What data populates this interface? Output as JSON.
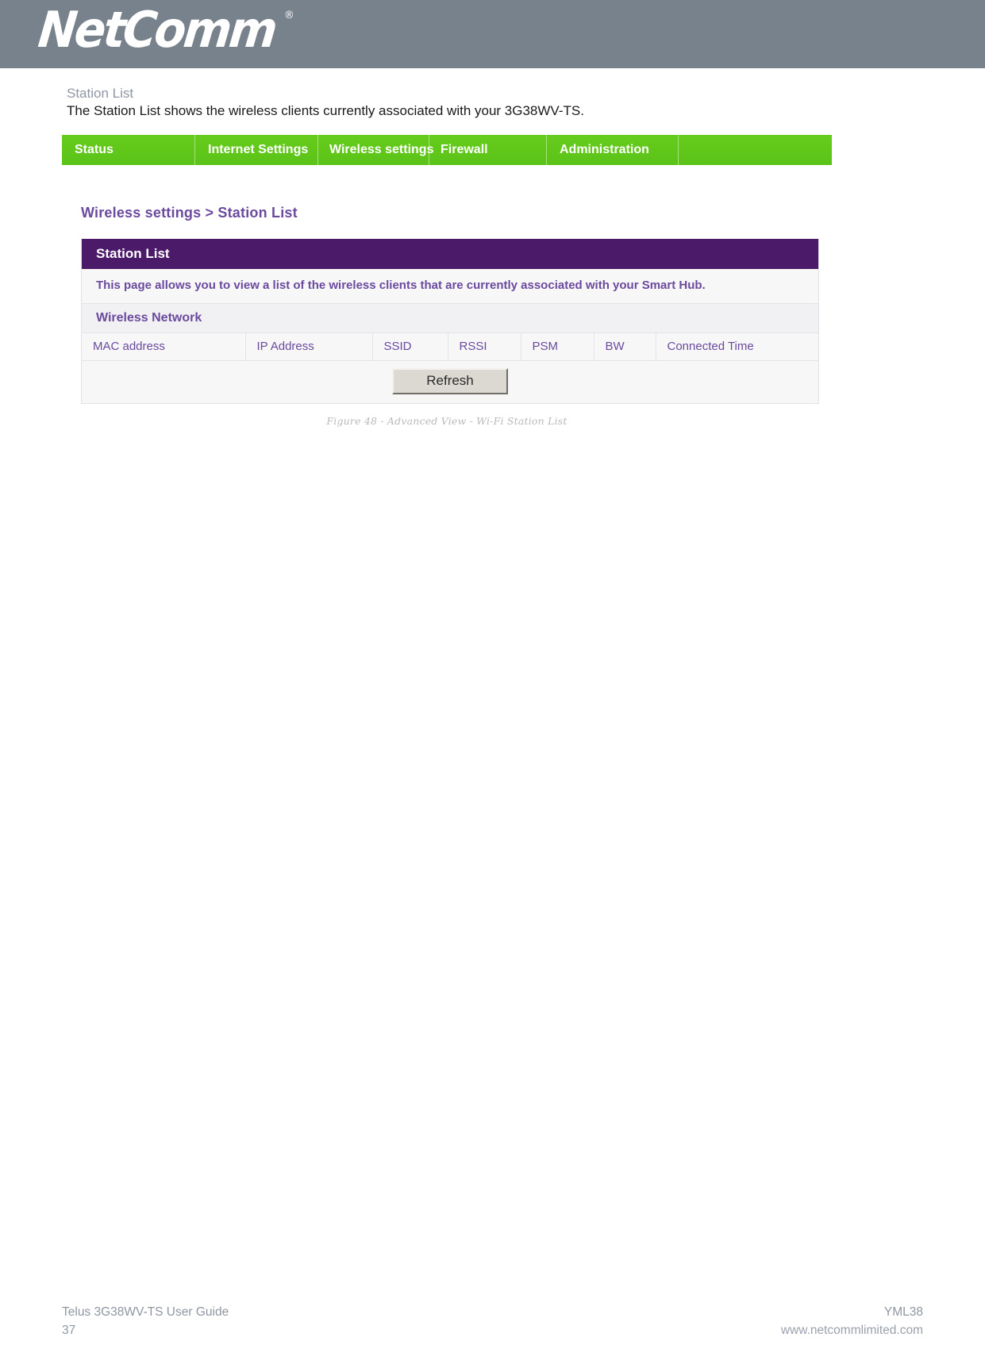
{
  "brand": {
    "logo_text": "NetComm",
    "logo_trademark": "®",
    "header_bg": "#78828c"
  },
  "doc": {
    "section_title": "Station List",
    "section_body": "The Station List shows the wireless clients currently associated with your 3G38WV-TS.",
    "figure_caption": "Figure 48 - Advanced View - Wi-Fi Station List"
  },
  "router_ui": {
    "nav": {
      "accent": "#5ec51a",
      "items": [
        {
          "label": "Status"
        },
        {
          "label": "Internet Settings"
        },
        {
          "label": "Wireless settings"
        },
        {
          "label": "Firewall"
        },
        {
          "label": "Administration"
        },
        {
          "label": ""
        }
      ]
    },
    "breadcrumb": "Wireless settings > Station List",
    "panel": {
      "accent": "#4b1a68",
      "title": "Station List",
      "description": "This page allows you to view a list of the wireless clients that are currently associated with your Smart Hub.",
      "subsection": "Wireless Network",
      "table": {
        "columns": [
          "MAC address",
          "IP Address",
          "SSID",
          "RSSI",
          "PSM",
          "BW",
          "Connected Time"
        ],
        "rows": []
      },
      "refresh_label": "Refresh"
    }
  },
  "footer": {
    "left_line1": "Telus 3G38WV-TS User Guide",
    "left_line2": "37",
    "right_line1": "YML38",
    "right_line2": "www.netcommlimited.com"
  }
}
